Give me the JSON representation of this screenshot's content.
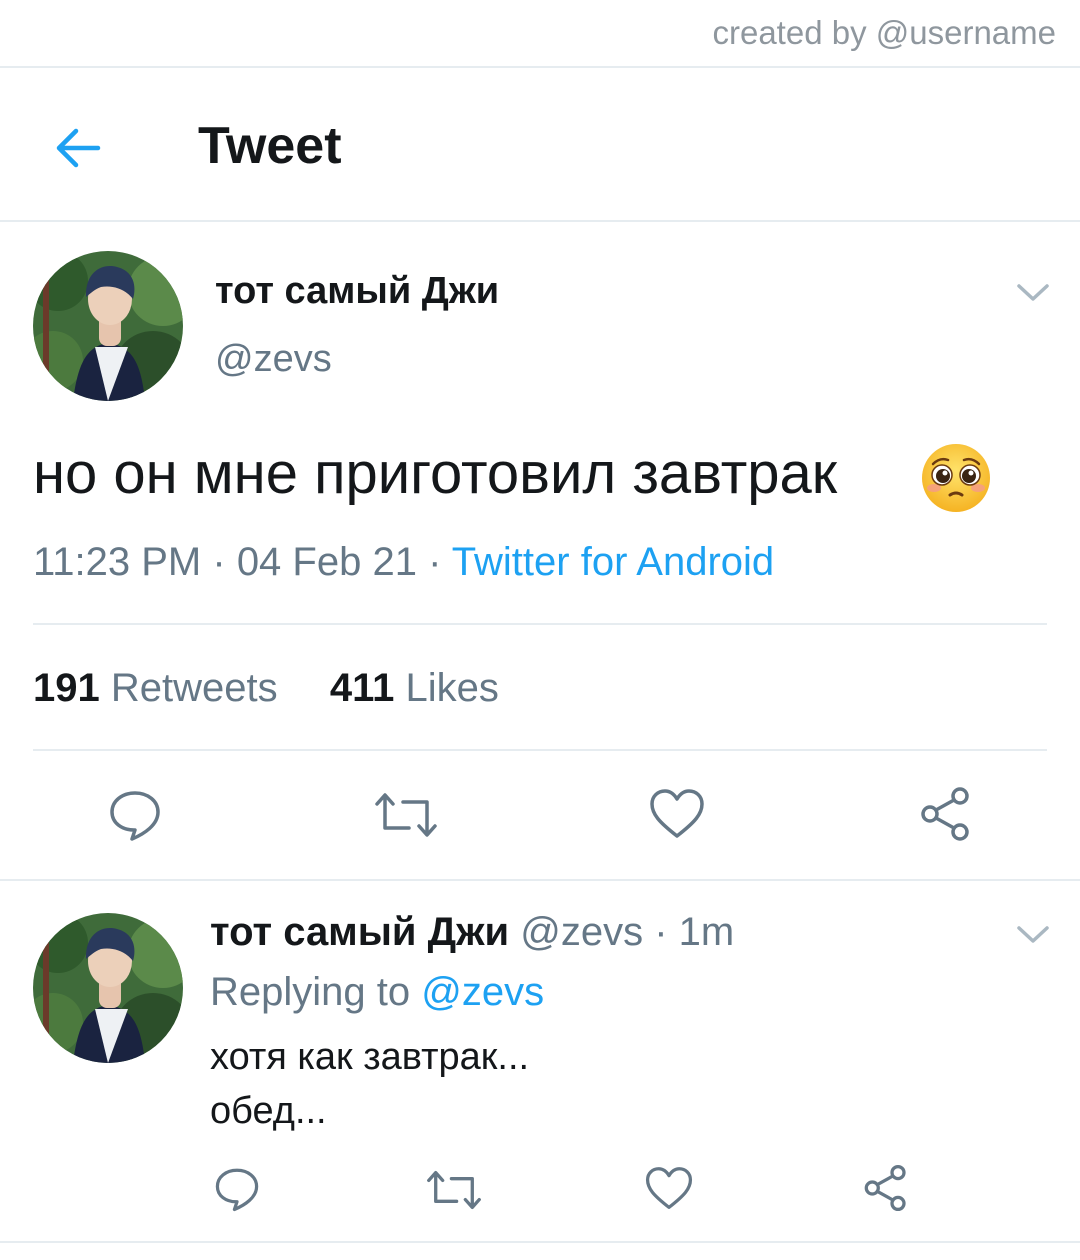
{
  "watermark": "created by @username",
  "header": {
    "title": "Tweet",
    "back_icon": "arrow-left-icon"
  },
  "colors": {
    "accent": "#1da1f2",
    "secondary_text": "#657786",
    "divider": "#e6ecf0"
  },
  "tweet": {
    "name": "тот самый Джи",
    "handle": "@zevs",
    "text": "но он мне приготовил завтрак",
    "emoji": "pleading-face-emoji",
    "time": "11:23 PM",
    "date": "04 Feb 21",
    "source": "Twitter for Android",
    "retweets_count": "191",
    "retweets_label": "Retweets",
    "likes_count": "411",
    "likes_label": "Likes"
  },
  "reply": {
    "name": "тот самый Джи",
    "handle": "@zevs",
    "age": "1m",
    "replying_prefix": "Replying to",
    "replying_to": "@zevs",
    "text_line1": "хотя как завтрак...",
    "text_line2": "обед..."
  }
}
